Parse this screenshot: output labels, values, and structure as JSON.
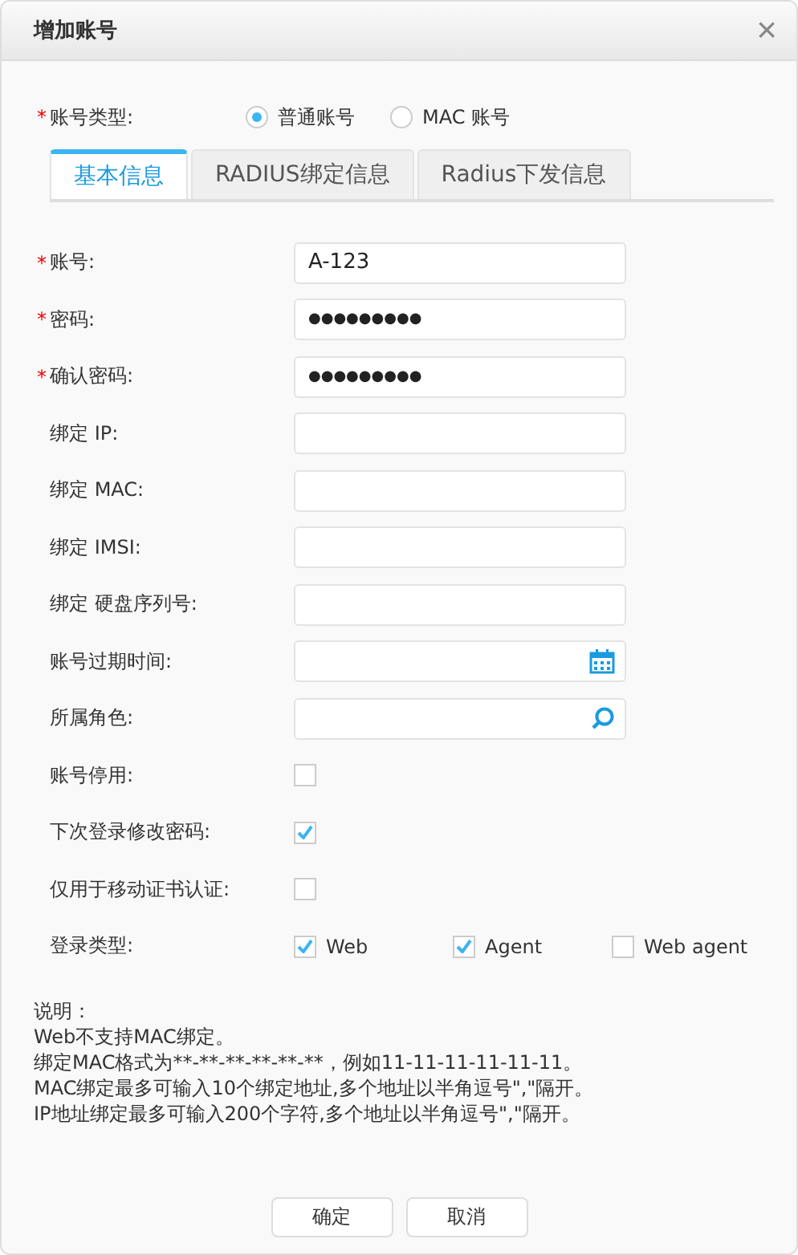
{
  "window": {
    "title": "增加账号",
    "close": "×"
  },
  "account_type": {
    "label": "账号类型:",
    "mark": "*",
    "options": [
      {
        "label": "普通账号",
        "selected": true
      },
      {
        "label": "MAC 账号",
        "selected": false
      }
    ]
  },
  "tabs": [
    {
      "label": "基本信息",
      "selected": true
    },
    {
      "label": "RADIUS绑定信息",
      "selected": false
    },
    {
      "label": "Radius下发信息",
      "selected": false
    }
  ],
  "fields": [
    {
      "kind": "text",
      "label": "账号:",
      "mark": "*",
      "value": "A-123"
    },
    {
      "kind": "password",
      "label": "密码:",
      "mark": "*",
      "value": "●●●●●●●●●"
    },
    {
      "kind": "password",
      "label": "确认密码:",
      "mark": "*",
      "value": "●●●●●●●●●"
    },
    {
      "kind": "text",
      "label": "绑定 IP:"
    },
    {
      "kind": "text",
      "label": "绑定 MAC:"
    },
    {
      "kind": "text",
      "label": "绑定 IMSI:"
    },
    {
      "kind": "text",
      "label": "绑定 硬盘序列号:"
    },
    {
      "kind": "date",
      "label": "账号过期时间:"
    },
    {
      "kind": "search",
      "label": "所属角色:"
    },
    {
      "kind": "checkbox",
      "label": "账号停用:",
      "checked": false
    },
    {
      "kind": "checkbox",
      "label": "下次登录修改密码:",
      "checked": true
    },
    {
      "kind": "checkbox",
      "label": "仅用于移动证书认证:",
      "checked": false
    },
    {
      "kind": "checkgroup",
      "label": "登录类型:",
      "options": [
        {
          "label": "Web",
          "checked": true
        },
        {
          "label": "Agent",
          "checked": true
        },
        {
          "label": "Web agent",
          "checked": false
        }
      ]
    }
  ],
  "notes": [
    "说明：",
    "Web不支持MAC绑定。",
    "绑定MAC格式为**-**-**-**-**-**，例如11-11-11-11-11-11。",
    "MAC绑定最多可输入10个绑定地址,多个地址以半角逗号\",\"隔开。",
    "IP地址绑定最多可输入200个字符,多个地址以半角逗号\",\"隔开。"
  ],
  "buttons": [
    "确定",
    "取消"
  ]
}
